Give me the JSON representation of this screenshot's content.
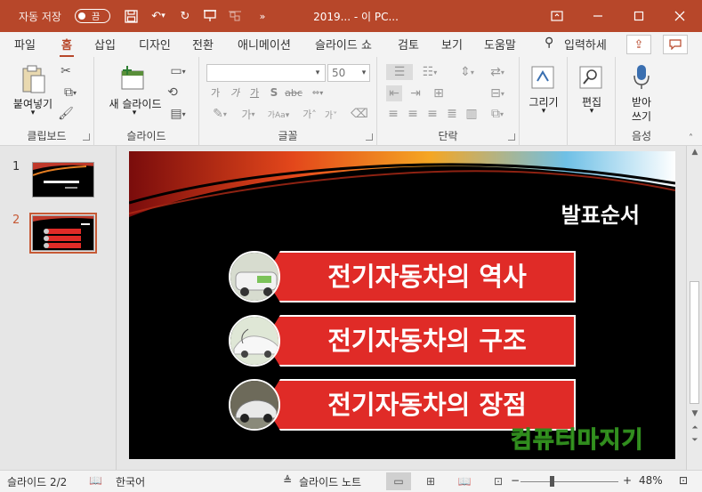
{
  "titlebar": {
    "autosave_label": "자동 저장",
    "autosave_state": "끔",
    "doc_title": "2019...  -  이 PC...",
    "bg_color": "#b7472a"
  },
  "tabs": [
    {
      "label": "파일"
    },
    {
      "label": "홈"
    },
    {
      "label": "삽입"
    },
    {
      "label": "디자인"
    },
    {
      "label": "전환"
    },
    {
      "label": "애니메이션"
    },
    {
      "label": "슬라이드 쇼"
    },
    {
      "label": "검토"
    },
    {
      "label": "보기"
    },
    {
      "label": "도움말"
    },
    {
      "label": "입력하세"
    }
  ],
  "ribbon": {
    "clipboard": {
      "label": "클립보드",
      "paste_label": "붙여넣기"
    },
    "slides": {
      "label": "슬라이드",
      "new_slide_label": "새 슬라이드"
    },
    "font": {
      "label": "글꼴",
      "font_name": "",
      "font_size": "50"
    },
    "paragraph": {
      "label": "단락"
    },
    "drawing": {
      "label": "그리기"
    },
    "editing": {
      "label": "편집"
    },
    "voice": {
      "label": "음성",
      "dictate_label1": "받아",
      "dictate_label2": "쓰기"
    }
  },
  "thumbnails": [
    {
      "number": "1"
    },
    {
      "number": "2"
    }
  ],
  "slide": {
    "title": "발표순서",
    "items": [
      {
        "label": "전기자동차의 역사"
      },
      {
        "label": "전기자동차의 구조"
      },
      {
        "label": "전기자동차의 장점"
      }
    ],
    "accent": "#e02b27"
  },
  "watermark": "컴퓨터마지기",
  "status": {
    "slide_info": "슬라이드 2/2",
    "language": "한국어",
    "notes_label": "슬라이드 노트",
    "zoom_minus": "−",
    "zoom_plus": "+",
    "zoom_level": "48%"
  }
}
